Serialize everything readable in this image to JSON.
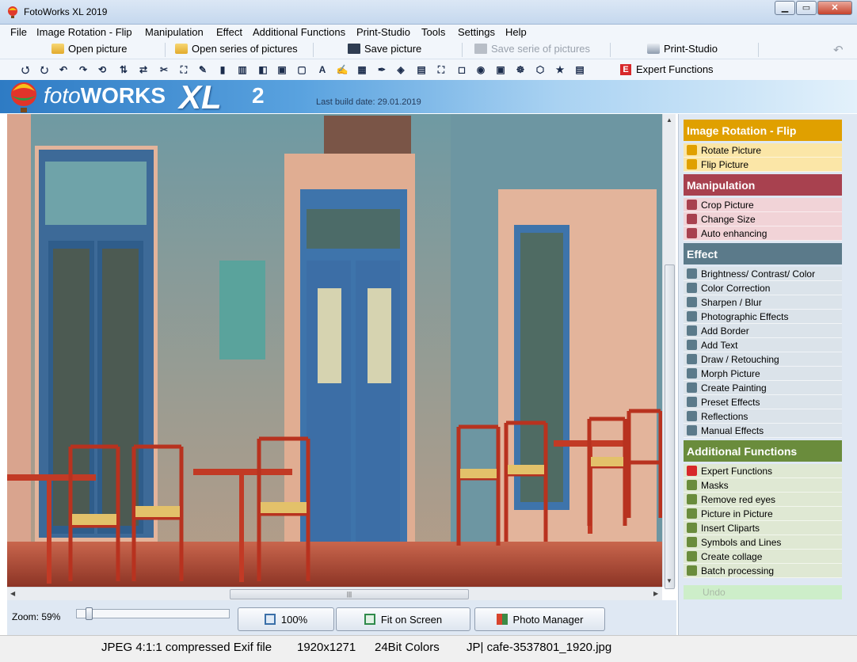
{
  "window": {
    "title": "FotoWorks XL 2019",
    "buttons": {
      "minimize": "▁",
      "maximize": "▭",
      "close": "✕"
    }
  },
  "menu": [
    "File",
    "Image Rotation - Flip",
    "Manipulation",
    "Effect",
    "Additional Functions",
    "Print-Studio",
    "Tools",
    "Settings",
    "Help"
  ],
  "toolbar": {
    "open_picture": "Open picture",
    "open_series": "Open series of pictures",
    "save_picture": "Save picture",
    "save_serie": "Save serie of pictures",
    "print_studio": "Print-Studio",
    "expert_functions": "Expert Functions",
    "expert_badge": "E"
  },
  "tool_icons": [
    "rotate-left-icon",
    "rotate-right-icon",
    "rotate-ccw-icon",
    "rotate-cw-icon",
    "rotate-90-icon",
    "flip-vertical-icon",
    "flip-horizontal-icon",
    "crop-icon",
    "resize-icon",
    "auto-enhance-icon",
    "brightness-icon",
    "color-correction-icon",
    "sharpen-icon",
    "photo-effects-icon",
    "border-icon",
    "text-icon",
    "draw-icon",
    "morph-icon",
    "painting-icon",
    "preset-effects-icon",
    "reflections-icon",
    "manual-effects-icon",
    "masks-icon",
    "red-eye-icon",
    "picture-in-picture-icon",
    "cliparts-icon",
    "symbols-icon",
    "collage-icon",
    "batch-icon"
  ],
  "tool_glyphs": [
    "⭯",
    "⭮",
    "↶",
    "↷",
    "⟲",
    "⇅",
    "⇄",
    "✂",
    "⛶",
    "✎",
    "▮",
    "▥",
    "◧",
    "▣",
    "▢",
    "A",
    "✍",
    "▦",
    "✒",
    "◈",
    "▤",
    "⛶",
    "◻",
    "◉",
    "▣",
    "☸",
    "⬡",
    "★",
    "▤"
  ],
  "banner": {
    "logo_prefix": "foto",
    "logo_brand": "WORKS",
    "logo_xl": "XL",
    "logo_version": "2",
    "build_date": "Last build date: 29.01.2019"
  },
  "bottom": {
    "zoom_label": "Zoom: 59%",
    "zoom_value": 0.06,
    "btn_100": "100%",
    "btn_fit": "Fit on Screen",
    "btn_photo_manager": "Photo Manager"
  },
  "status": {
    "format": "JPEG 4:1:1 compressed Exif file",
    "dimensions": "1920x1271",
    "colors": "24Bit Colors",
    "file": "JP| cafe-3537801_1920.jpg"
  },
  "panel": {
    "sections": [
      {
        "title": "Image Rotation - Flip",
        "color": "#e0a000",
        "item_bg": "#fbe6a7",
        "items": [
          {
            "label": "Rotate Picture",
            "icon": "rotate-picture-icon"
          },
          {
            "label": "Flip Picture",
            "icon": "flip-picture-icon"
          }
        ]
      },
      {
        "title": "Manipulation",
        "color": "#a8414f",
        "item_bg": "#f1d3d7",
        "items": [
          {
            "label": "Crop Picture",
            "icon": "crop-icon"
          },
          {
            "label": "Change Size",
            "icon": "resize-icon"
          },
          {
            "label": "Auto enhancing",
            "icon": "auto-enhance-icon"
          }
        ]
      },
      {
        "title": "Effect",
        "color": "#5b7a8a",
        "item_bg": "#dbe3ea",
        "items": [
          {
            "label": "Brightness/ Contrast/ Color",
            "icon": "brightness-icon"
          },
          {
            "label": "Color Correction",
            "icon": "color-correction-icon"
          },
          {
            "label": "Sharpen / Blur",
            "icon": "sharpen-icon"
          },
          {
            "label": "Photographic Effects",
            "icon": "photo-effects-icon"
          },
          {
            "label": "Add Border",
            "icon": "border-icon"
          },
          {
            "label": "Add Text",
            "icon": "text-icon"
          },
          {
            "label": "Draw / Retouching",
            "icon": "draw-icon"
          },
          {
            "label": "Morph Picture",
            "icon": "morph-icon"
          },
          {
            "label": "Create Painting",
            "icon": "painting-icon"
          },
          {
            "label": "Preset Effects",
            "icon": "preset-effects-icon"
          },
          {
            "label": "Reflections",
            "icon": "reflections-icon"
          },
          {
            "label": "Manual Effects",
            "icon": "manual-effects-icon"
          }
        ]
      },
      {
        "title": "Additional Functions",
        "color": "#6a8c3c",
        "item_bg": "#dfe8d3",
        "items": [
          {
            "label": "Expert Functions",
            "icon": "expert-icon"
          },
          {
            "label": "Masks",
            "icon": "masks-icon"
          },
          {
            "label": "Remove red eyes",
            "icon": "red-eye-icon"
          },
          {
            "label": "Picture in Picture",
            "icon": "picture-in-picture-icon"
          },
          {
            "label": "Insert Cliparts",
            "icon": "cliparts-icon"
          },
          {
            "label": "Symbols and Lines",
            "icon": "symbols-icon"
          },
          {
            "label": "Create collage",
            "icon": "collage-icon"
          },
          {
            "label": "Batch processing",
            "icon": "batch-icon"
          }
        ]
      }
    ],
    "undo": "Undo"
  },
  "colors": {
    "accent": "#2e7bc4",
    "expert_red": "#d7282a"
  }
}
